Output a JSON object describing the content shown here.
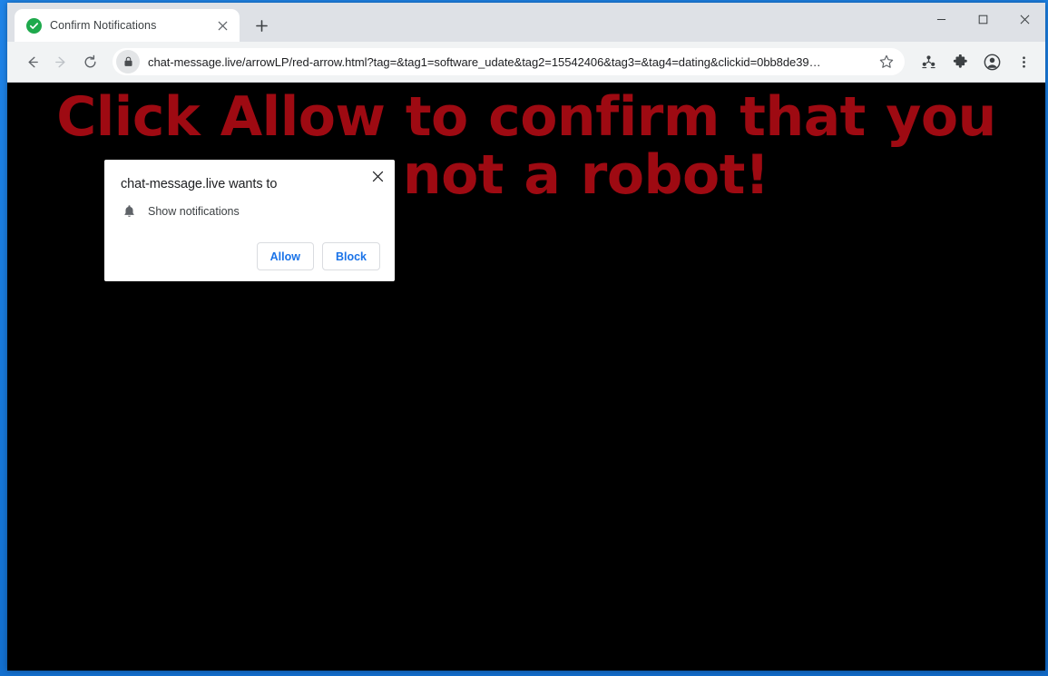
{
  "window": {
    "controls": {
      "minimize_label": "Minimize",
      "maximize_label": "Maximize",
      "close_label": "Close"
    }
  },
  "tabstrip": {
    "tabs": [
      {
        "title": "Confirm Notifications",
        "favicon": "green-check-circle-icon",
        "close_label": "Close tab"
      }
    ],
    "new_tab_label": "New Tab"
  },
  "toolbar": {
    "back_label": "Back",
    "forward_label": "Forward",
    "reload_label": "Reload this page",
    "security_icon": "lock-icon",
    "url": "chat-message.live/arrowLP/red-arrow.html?tag=&tag1=software_udate&tag2=15542406&tag3=&tag4=dating&clickid=0bb8de39…",
    "bookmark_label": "Bookmark this tab",
    "icons": [
      {
        "name": "profile-share-icon"
      },
      {
        "name": "puzzle-piece-icon"
      },
      {
        "name": "account-avatar-icon"
      },
      {
        "name": "three-dot-menu-icon"
      }
    ]
  },
  "page": {
    "background_color": "#000000",
    "headline_color": "#9e0a12",
    "headline": "Click Allow to confirm that you are not a robot!"
  },
  "permission_dialog": {
    "title": "chat-message.live wants to",
    "permission_icon": "bell-icon",
    "permission_label": "Show notifications",
    "allow_label": "Allow",
    "block_label": "Block",
    "close_label": "Close",
    "accent_color": "#1a73e8"
  }
}
